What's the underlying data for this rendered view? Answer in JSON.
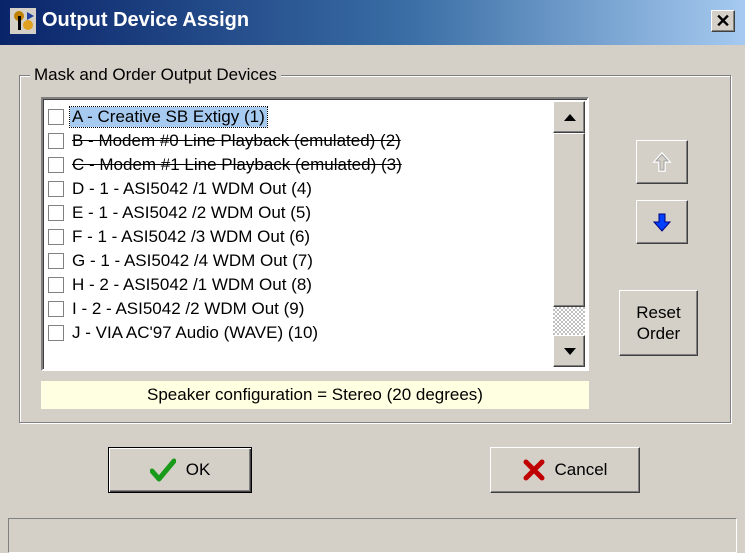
{
  "window": {
    "title": "Output Device Assign",
    "close_glyph": "✕",
    "accent_color": "#0a246a"
  },
  "group": {
    "label": "Mask and Order Output Devices"
  },
  "devices": [
    {
      "label": "A  - Creative SB Extigy (1)",
      "checked": false,
      "selected": true,
      "struck": false
    },
    {
      "label": "B  - Modem #0 Line Playback (emulated) (2)",
      "checked": false,
      "selected": false,
      "struck": true
    },
    {
      "label": "C  - Modem #1 Line Playback (emulated) (3)",
      "checked": false,
      "selected": false,
      "struck": true
    },
    {
      "label": "D - 1 - ASI5042 /1 WDM Out (4)",
      "checked": false,
      "selected": false,
      "struck": false
    },
    {
      "label": "E  - 1 - ASI5042 /2 WDM Out (5)",
      "checked": false,
      "selected": false,
      "struck": false
    },
    {
      "label": "F  - 1 - ASI5042 /3 WDM Out (6)",
      "checked": false,
      "selected": false,
      "struck": false
    },
    {
      "label": "G - 1 - ASI5042 /4 WDM Out (7)",
      "checked": false,
      "selected": false,
      "struck": false
    },
    {
      "label": "H - 2 - ASI5042 /1 WDM Out (8)",
      "checked": false,
      "selected": false,
      "struck": false
    },
    {
      "label": "I   - 2 - ASI5042 /2 WDM Out (9)",
      "checked": false,
      "selected": false,
      "struck": false
    },
    {
      "label": "J  - VIA AC'97 Audio (WAVE) (10)",
      "checked": false,
      "selected": false,
      "struck": false
    }
  ],
  "speaker_config": "Speaker configuration = Stereo (20 degrees)",
  "buttons": {
    "move_up_icon": "up-arrow-icon",
    "move_down_icon": "down-arrow-icon",
    "reset_line1": "Reset",
    "reset_line2": "Order",
    "ok_label": "OK",
    "cancel_label": "Cancel",
    "ok_icon_color": "#1a9a1a",
    "cancel_icon_color": "#c00000"
  }
}
